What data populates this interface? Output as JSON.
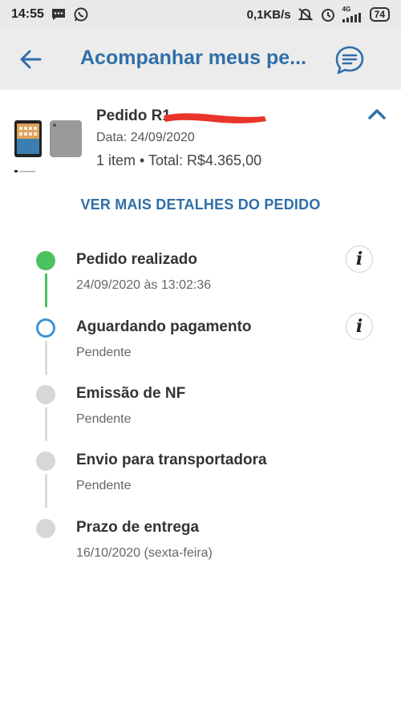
{
  "status_bar": {
    "time": "14:55",
    "network_speed": "0,1KB/s",
    "network_type": "4G",
    "battery": "74",
    "icons": [
      "message-icon",
      "whatsapp-icon",
      "mute-icon",
      "alarm-icon",
      "signal-icon",
      "battery-icon"
    ]
  },
  "header": {
    "title": "Acompanhar meus pe...",
    "back_icon": "arrow-left-icon",
    "chat_icon": "chat-icon"
  },
  "order": {
    "id_prefix": "Pedido R1",
    "date": "Data: 24/09/2020",
    "summary": "1 item • Total: R$4.365,00",
    "collapse_icon": "chevron-up-icon"
  },
  "details_link": "VER MAIS DETALHES DO PEDIDO",
  "timeline": [
    {
      "title": "Pedido realizado",
      "subtitle": "24/09/2020 às 13:02:36",
      "state": "done",
      "has_info": true
    },
    {
      "title": "Aguardando pagamento",
      "subtitle": "Pendente",
      "state": "current",
      "has_info": true
    },
    {
      "title": "Emissão de NF",
      "subtitle": "Pendente",
      "state": "pending",
      "has_info": false
    },
    {
      "title": "Envio para transportadora",
      "subtitle": "Pendente",
      "state": "pending",
      "has_info": false
    },
    {
      "title": "Prazo de entrega",
      "subtitle": "16/10/2020 (sexta-feira)",
      "state": "pending",
      "has_info": false
    }
  ],
  "info_label": "i",
  "colors": {
    "accent": "#2f6fa8",
    "done": "#4cc15f",
    "current": "#3a94d6",
    "pending": "#d7d7d7"
  }
}
